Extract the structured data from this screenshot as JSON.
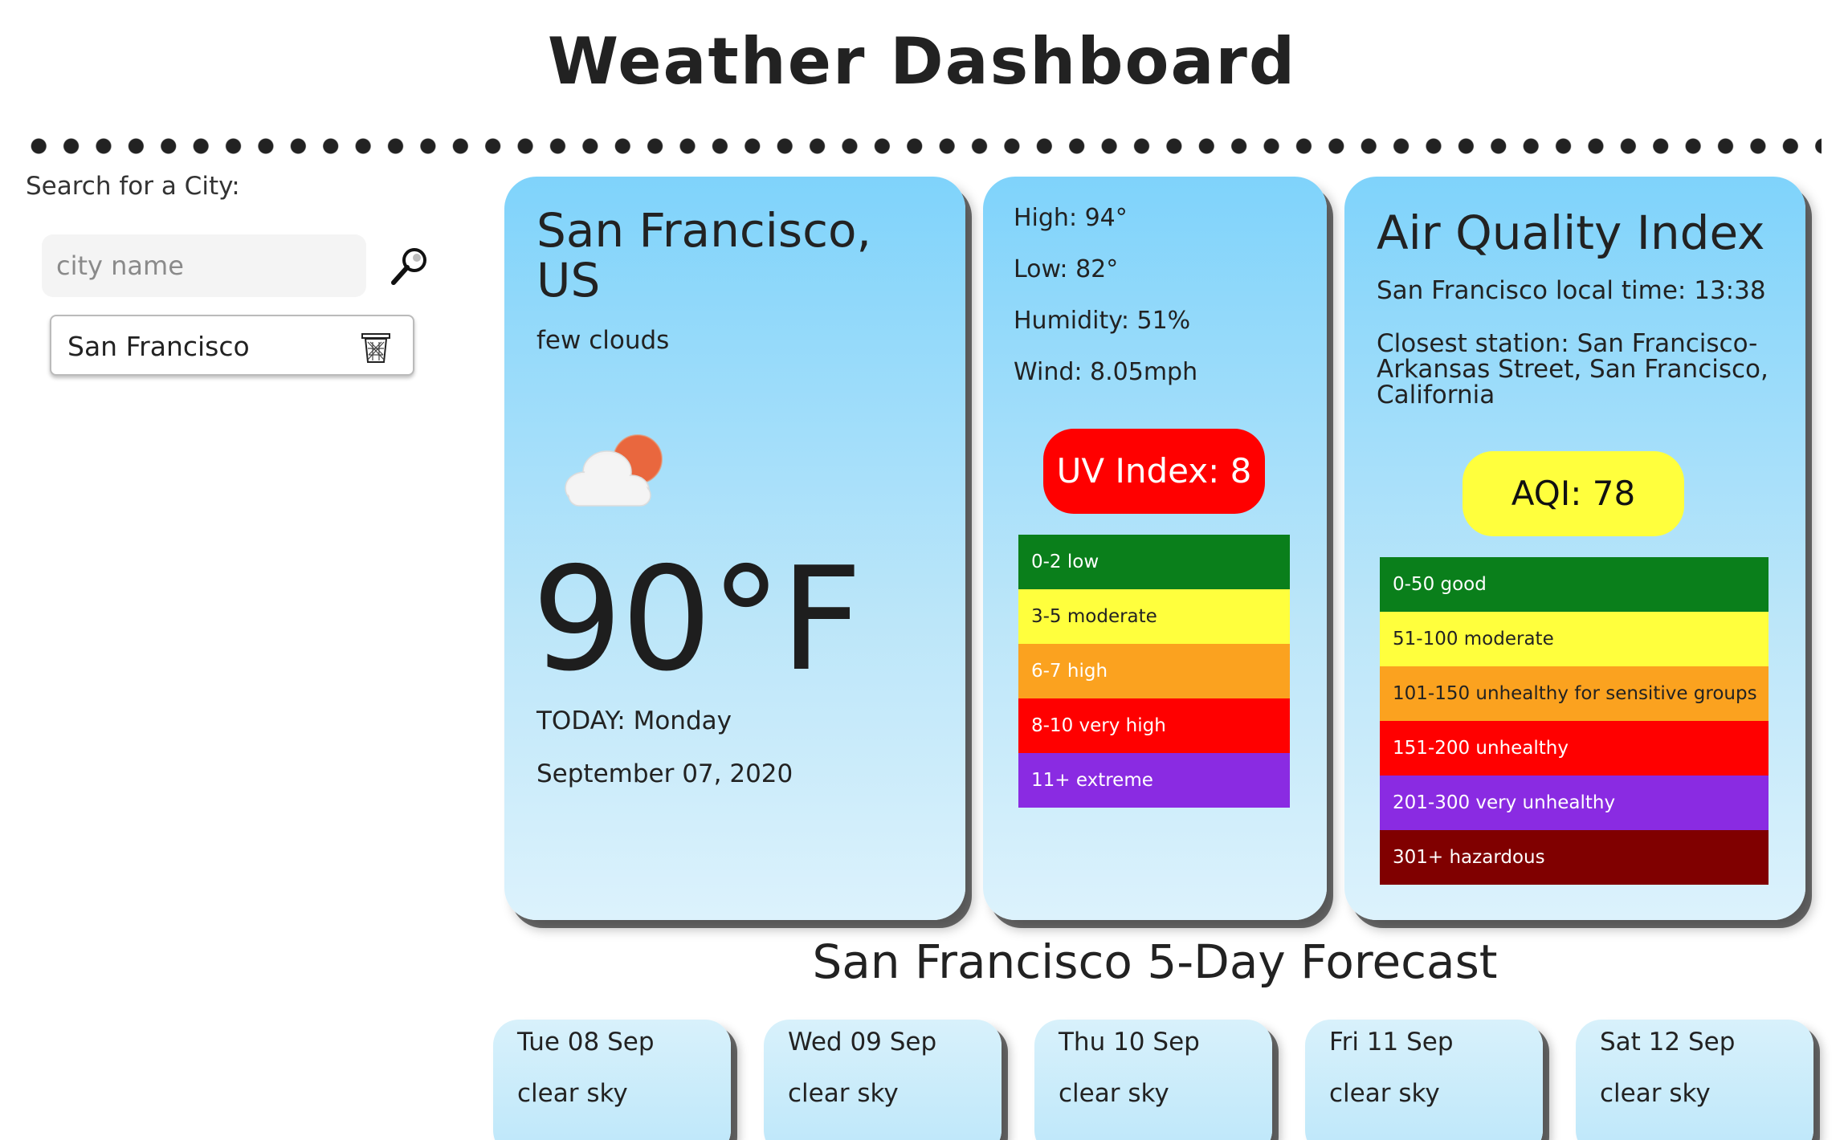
{
  "header": {
    "title": "Weather Dashboard"
  },
  "sidebar": {
    "search_label": "Search for a City:",
    "search_placeholder": "city name",
    "history": [
      {
        "label": "San Francisco"
      }
    ]
  },
  "current": {
    "city": "San Francisco, US",
    "condition": "few clouds",
    "icon": "partly-cloudy-icon",
    "temperature": "90°F",
    "today_label": "TODAY: Monday",
    "date": "September 07, 2020"
  },
  "details": {
    "high": "High: 94°",
    "low": "Low: 82°",
    "humidity": "Humidity: 51%",
    "wind": "Wind: 8.05mph",
    "uv_label": "UV Index: 8",
    "uv_scale": [
      {
        "label": "0-2 low",
        "color": "#0a7f1b",
        "text_color": "#ffffff"
      },
      {
        "label": "3-5 moderate",
        "color": "#ffff3d",
        "text_color": "#222222"
      },
      {
        "label": "6-7 high",
        "color": "#fba21f",
        "text_color": "#ffffff"
      },
      {
        "label": "8-10 very high",
        "color": "#ff0000",
        "text_color": "#ffffff"
      },
      {
        "label": "11+ extreme",
        "color": "#8a2be2",
        "text_color": "#ffffff"
      }
    ]
  },
  "air_quality": {
    "title": "Air Quality Index",
    "local_time": "San Francisco local time: 13:38",
    "station": "Closest station: San Francisco-Arkansas Street, San Francisco, California",
    "aqi_label": "AQI: 78",
    "scale": [
      {
        "label": "0-50 good",
        "color": "#0a7f1b",
        "text_color": "#ffffff"
      },
      {
        "label": "51-100 moderate",
        "color": "#ffff3d",
        "text_color": "#222222"
      },
      {
        "label": "101-150 unhealthy for sensitive groups",
        "color": "#fba21f",
        "text_color": "#222222"
      },
      {
        "label": "151-200 unhealthy",
        "color": "#ff0000",
        "text_color": "#ffffff"
      },
      {
        "label": "201-300 very unhealthy",
        "color": "#8a2be2",
        "text_color": "#ffffff"
      },
      {
        "label": "301+ hazardous",
        "color": "#800000",
        "text_color": "#ffffff"
      }
    ]
  },
  "forecast": {
    "title": "San Francisco 5-Day Forecast",
    "days": [
      {
        "date": "Tue 08 Sep",
        "condition": "clear sky"
      },
      {
        "date": "Wed 09 Sep",
        "condition": "clear sky"
      },
      {
        "date": "Thu 10 Sep",
        "condition": "clear sky"
      },
      {
        "date": "Fri 11 Sep",
        "condition": "clear sky"
      },
      {
        "date": "Sat 12 Sep",
        "condition": "clear sky"
      }
    ]
  }
}
